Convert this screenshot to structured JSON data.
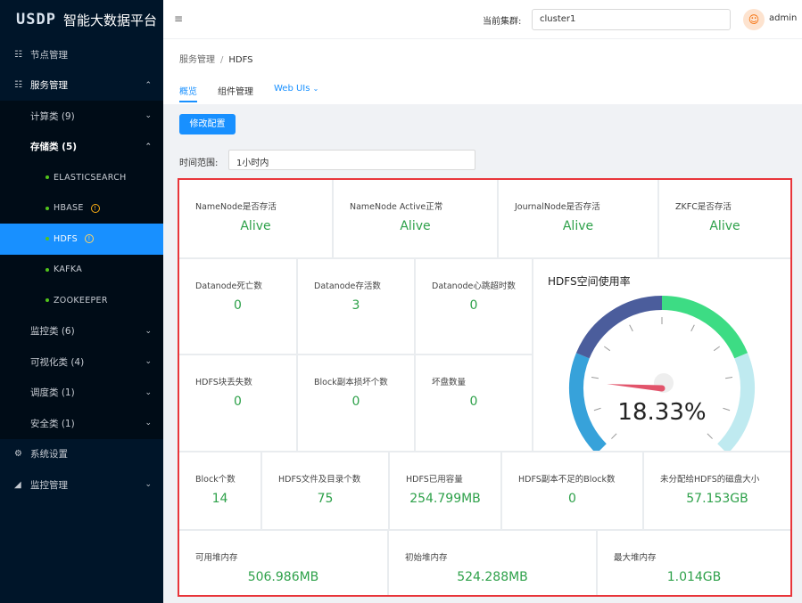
{
  "app": {
    "logo": "USDP",
    "title": "智能大数据平台"
  },
  "sidebar": {
    "nodes": "节点管理",
    "services": "服务管理",
    "compute": "计算类 (9)",
    "storage": "存储类 (5)",
    "leaves": [
      "ELASTICSEARCH",
      "HBASE",
      "HDFS",
      "KAFKA",
      "ZOOKEEPER"
    ],
    "monitor_cat": "监控类 (6)",
    "visual_cat": "可视化类 (4)",
    "schedule_cat": "调度类 (1)",
    "security_cat": "安全类 (1)",
    "settings": "系统设置",
    "monitor_mgmt": "监控管理"
  },
  "header": {
    "cluster_label": "当前集群:",
    "cluster_value": "cluster1",
    "user": "admin"
  },
  "breadcrumb": {
    "parent": "服务管理",
    "separator": "/",
    "current": "HDFS"
  },
  "tabs": [
    "概览",
    "组件管理",
    "Web UIs"
  ],
  "toolbar": {
    "edit_config": "修改配置",
    "time_label": "时间范围:",
    "time_value": "1小时内"
  },
  "status_row": [
    {
      "label": "NameNode是否存活",
      "value": "Alive"
    },
    {
      "label": "NameNode Active正常",
      "value": "Alive"
    },
    {
      "label": "JournalNode是否存活",
      "value": "Alive"
    },
    {
      "label": "ZKFC是否存活",
      "value": "Alive"
    }
  ],
  "datanode_row": [
    {
      "label": "Datanode死亡数",
      "value": "0"
    },
    {
      "label": "Datanode存活数",
      "value": "3"
    },
    {
      "label": "Datanode心跳超时数",
      "value": "0"
    }
  ],
  "block_row": [
    {
      "label": "HDFS块丢失数",
      "value": "0"
    },
    {
      "label": "Block副本损坏个数",
      "value": "0"
    },
    {
      "label": "坏盘数量",
      "value": "0"
    }
  ],
  "gauge": {
    "title": "HDFS空间使用率",
    "value": 18.33,
    "display": "18.33%"
  },
  "capacity_row": [
    {
      "label": "Block个数",
      "value": "14"
    },
    {
      "label": "HDFS文件及目录个数",
      "value": "75"
    },
    {
      "label": "HDFS已用容量",
      "value": "254.799MB"
    },
    {
      "label": "HDFS副本不足的Block数",
      "value": "0"
    },
    {
      "label": "未分配给HDFS的磁盘大小",
      "value": "57.153GB"
    }
  ],
  "heap_row": [
    {
      "label": "可用堆内存",
      "value": "506.986MB"
    },
    {
      "label": "初始堆内存",
      "value": "524.288MB"
    },
    {
      "label": "最大堆内存",
      "value": "1.014GB"
    }
  ],
  "colors": {
    "accent": "#1890ff",
    "value_green": "#2ea14a",
    "highlight_border": "#e8353a",
    "sidebar_bg": "#001529"
  }
}
